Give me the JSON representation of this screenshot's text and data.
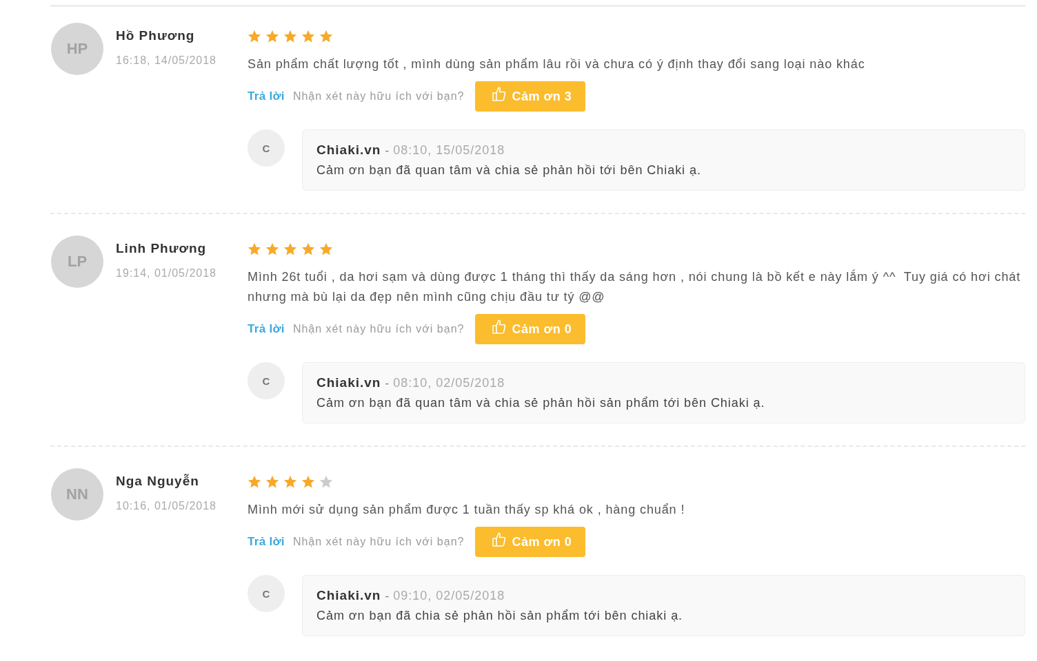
{
  "reviews": [
    {
      "avatar": "HP",
      "name": "Hồ Phương",
      "time": "16:18, 14/05/2018",
      "stars": 5,
      "comment": "Sản phẩm chất lượng tốt , mình dùng sản phẩm lâu rồi và chưa có ý định thay đổi sang loại nào khác",
      "reply_link": "Trả lời",
      "helpful_question": "Nhận xét này hữu ích với bạn?",
      "thanks_button": "Cảm ơn 3",
      "shop_reply": {
        "avatar": "C",
        "author": "Chiaki.vn",
        "separator": "-",
        "time": "08:10, 15/05/2018",
        "text": "Cảm ơn bạn đã quan tâm và chia sẻ phản hồi tới bên Chiaki ạ."
      }
    },
    {
      "avatar": "LP",
      "name": "Linh Phương",
      "time": "19:14, 01/05/2018",
      "stars": 5,
      "comment": "Mình 26t tuổi , da hơi sạm và dùng được 1 tháng thì thấy da sáng hơn , nói chung là bồ kết e này lắm ý ^^  Tuy giá có hơi chát nhưng mà bù lại da đẹp nên mình cũng chịu đầu tư tý @@",
      "reply_link": "Trả lời",
      "helpful_question": "Nhận xét này hữu ích với bạn?",
      "thanks_button": "Cảm ơn 0",
      "shop_reply": {
        "avatar": "C",
        "author": "Chiaki.vn",
        "separator": "-",
        "time": "08:10, 02/05/2018",
        "text": "Cảm ơn bạn đã quan tâm và chia sẻ phản hồi sản phẩm tới bên Chiaki ạ."
      }
    },
    {
      "avatar": "NN",
      "name": "Nga Nguyễn",
      "time": "10:16, 01/05/2018",
      "stars": 4,
      "comment": "Mình mới sử dụng sản phẩm được 1 tuần thấy sp khá ok , hàng chuẩn !",
      "reply_link": "Trả lời",
      "helpful_question": "Nhận xét này hữu ích với bạn?",
      "thanks_button": "Cảm ơn 0",
      "shop_reply": {
        "avatar": "C",
        "author": "Chiaki.vn",
        "separator": "-",
        "time": "09:10, 02/05/2018",
        "text": "Cảm ơn bạn đã chia sẻ phản hồi sản phẩm tới bên chiaki ạ."
      }
    }
  ]
}
